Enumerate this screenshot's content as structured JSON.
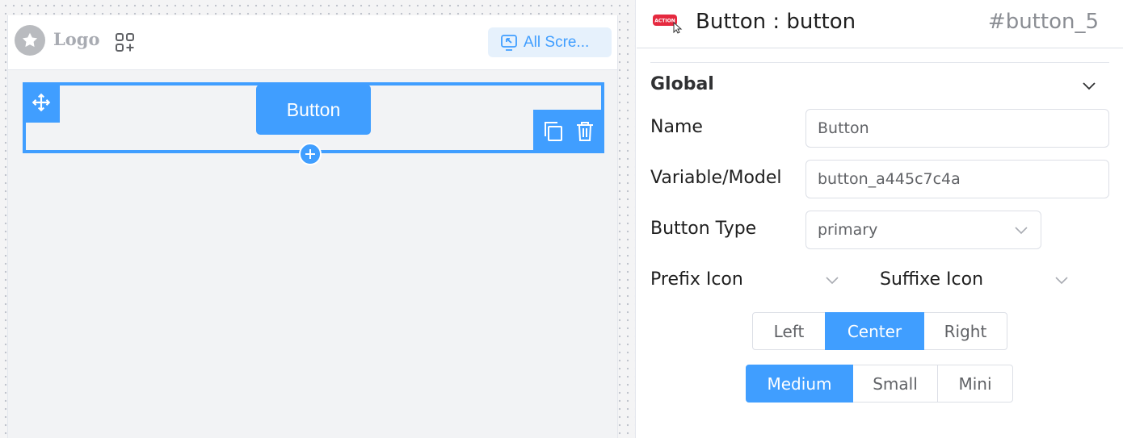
{
  "canvas": {
    "header": {
      "logo_text": "Logo",
      "screens_button_label": "All Scre..."
    },
    "preview_button_label": "Button"
  },
  "panel": {
    "action_badge": "ACTION",
    "title": "Button : button",
    "widget_id": "#button_5",
    "section": {
      "title": "Global"
    },
    "fields": {
      "name_label": "Name",
      "name_value": "Button",
      "variable_label": "Variable/Model",
      "variable_value": "button_a445c7c4a",
      "button_type_label": "Button Type",
      "button_type_value": "primary",
      "prefix_icon_label": "Prefix Icon",
      "suffix_icon_label": "Suffixe Icon"
    },
    "alignment": {
      "options": [
        "Left",
        "Center",
        "Right"
      ],
      "selected": "Center"
    },
    "size": {
      "options": [
        "Medium",
        "Small",
        "Mini"
      ],
      "selected": "Medium"
    }
  },
  "colors": {
    "primary": "#409eff",
    "canvas_bg": "#f2f3f5",
    "badge_red": "#e5293f"
  },
  "icons": [
    "star-icon",
    "apps-add-icon",
    "screen-cursor-icon",
    "move-icon",
    "copy-icon",
    "trash-icon",
    "plus-icon",
    "action-badge-icon",
    "chevron-down-icon"
  ]
}
